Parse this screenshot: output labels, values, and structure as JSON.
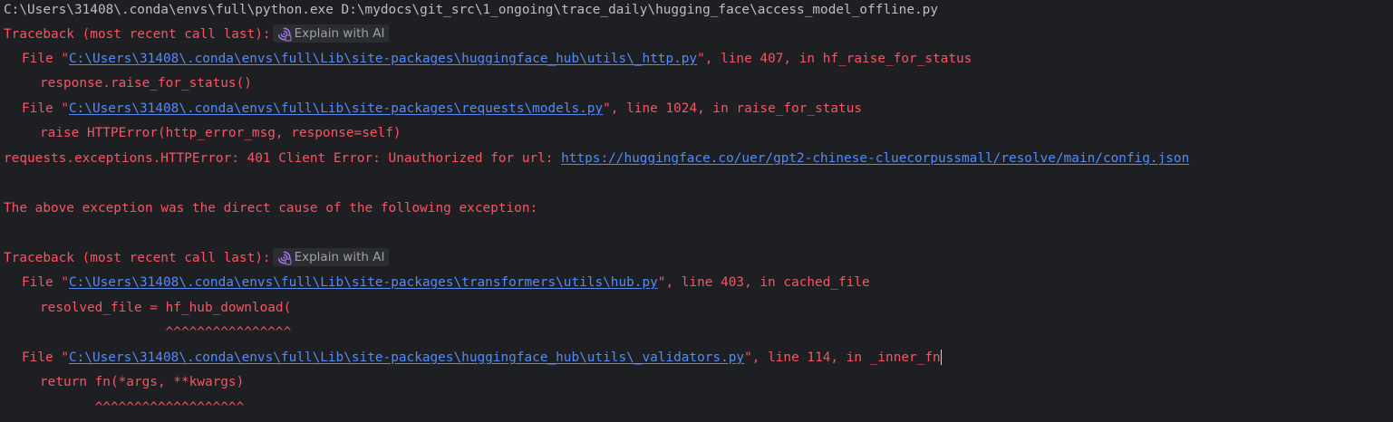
{
  "console": {
    "command": "C:\\Users\\31408\\.conda\\envs\\full\\python.exe D:\\mydocs\\git_src\\1_ongoing\\trace_daily\\hugging_face\\access_model_offline.py",
    "traceback_header": "Traceback (most recent call last):",
    "explain_ai_label": "Explain with AI",
    "file_prefix": "File \"",
    "block1": {
      "frame1": {
        "path": "C:\\Users\\31408\\.conda\\envs\\full\\Lib\\site-packages\\huggingface_hub\\utils\\_http.py",
        "suffix": "\", line 407, in hf_raise_for_status",
        "code": "response.raise_for_status()"
      },
      "frame2": {
        "path": "C:\\Users\\31408\\.conda\\envs\\full\\Lib\\site-packages\\requests\\models.py",
        "suffix": "\", line 1024, in raise_for_status",
        "code": "raise HTTPError(http_error_msg, response=self)"
      },
      "error_prefix": "requests.exceptions.HTTPError: 401 Client Error: Unauthorized for url: ",
      "error_url": "https://huggingface.co/uer/gpt2-chinese-cluecorpussmall/resolve/main/config.json"
    },
    "cause_message": "The above exception was the direct cause of the following exception:",
    "block2": {
      "frame1": {
        "path": "C:\\Users\\31408\\.conda\\envs\\full\\Lib\\site-packages\\transformers\\utils\\hub.py",
        "suffix": "\", line 403, in cached_file",
        "code": "resolved_file = hf_hub_download(",
        "carets": "                ^^^^^^^^^^^^^^^^"
      },
      "frame2": {
        "path": "C:\\Users\\31408\\.conda\\envs\\full\\Lib\\site-packages\\huggingface_hub\\utils\\_validators.py",
        "suffix": "\", line 114, in _inner_fn",
        "code": "return fn(*args, **kwargs)",
        "carets": "       ^^^^^^^^^^^^^^^^^^^"
      }
    }
  },
  "colors": {
    "background": "#1e1f22",
    "error_text": "#f75464",
    "command_text": "#bcbec4",
    "link": "#548af7",
    "ai_button_bg": "#2b2d30",
    "ai_icon": "#a571e6"
  },
  "icons": {
    "explain_ai": "ai-spiral-icon"
  }
}
